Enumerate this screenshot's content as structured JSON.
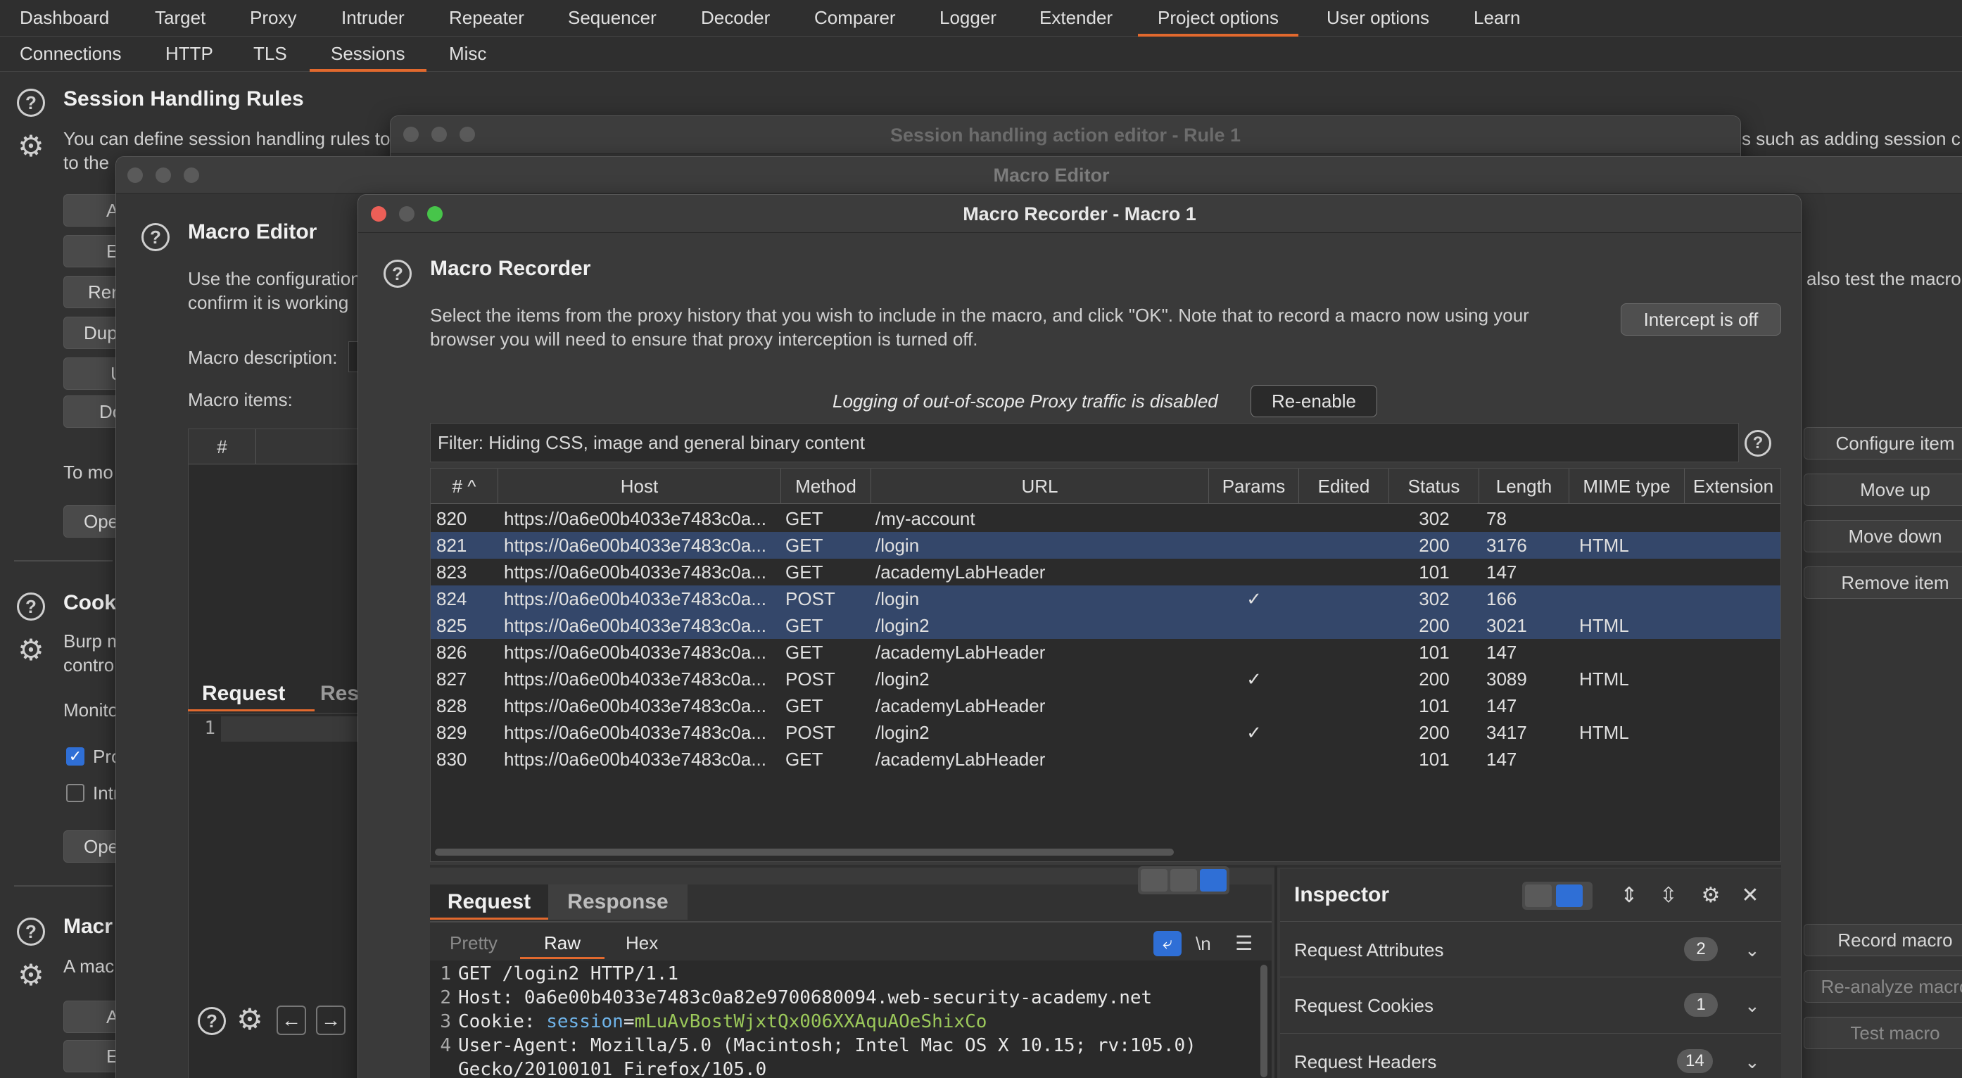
{
  "top_tabs": [
    {
      "label": "Dashboard"
    },
    {
      "label": "Target"
    },
    {
      "label": "Proxy"
    },
    {
      "label": "Intruder"
    },
    {
      "label": "Repeater"
    },
    {
      "label": "Sequencer"
    },
    {
      "label": "Decoder"
    },
    {
      "label": "Comparer"
    },
    {
      "label": "Logger"
    },
    {
      "label": "Extender"
    },
    {
      "label": "Project options"
    },
    {
      "label": "User options"
    },
    {
      "label": "Learn"
    }
  ],
  "sub_tabs": [
    {
      "label": "Connections"
    },
    {
      "label": "HTTP"
    },
    {
      "label": "TLS"
    },
    {
      "label": "Sessions"
    },
    {
      "label": "Misc"
    }
  ],
  "background": {
    "section_title": "Session Handling Rules",
    "desc_line1": "You can define session handling rules to",
    "desc_line1_right": "s such as adding session c",
    "desc_line2": "to the",
    "side_buttons": [
      "A",
      "E",
      "Ren",
      "Dup",
      "U",
      "Do"
    ],
    "to_mo": "To mo",
    "ope": "Ope",
    "cookie_title": "Cook",
    "cookie_desc1": "Burp m",
    "cookie_desc2": "contro",
    "monitor": "Monito",
    "check_proxy": "Pro",
    "check_intruder": "Intr",
    "ope2": "Ope",
    "macro_title": "Macr",
    "macro_desc": "A mac",
    "macro_btn_a": "A",
    "macro_btn_e": "E"
  },
  "session_action_editor": {
    "title": "Session handling action editor - Rule 1"
  },
  "macro_editor": {
    "title": "Macro Editor",
    "heading": "Macro Editor",
    "desc1": "Use the configuration",
    "desc1_right": "also test the macro",
    "desc2": "confirm it is working",
    "macro_description_label": "Macro description:",
    "macro_items_label": "Macro items:",
    "hash_col": "#",
    "request_tab": "Request",
    "response_tab": "Res",
    "line_number": "1",
    "to_mo": "To mo",
    "right_buttons": {
      "configure_item": "Configure item",
      "move_up": "Move up",
      "move_down": "Move down",
      "remove_item": "Remove item",
      "record_macro": "Record macro",
      "reanalyze_macro": "Re-analyze macro",
      "test_macro": "Test macro"
    }
  },
  "macro_recorder": {
    "title": "Macro Recorder - Macro 1",
    "heading": "Macro Recorder",
    "desc1": "Select the items from the proxy history that you wish to include in the macro, and click \"OK\". Note that to record a macro now using your",
    "desc2": "browser you will need to ensure that proxy interception is turned off.",
    "intercept_button": "Intercept is off",
    "logging_notice": "Logging of out-of-scope Proxy traffic is disabled",
    "reenable_button": "Re-enable",
    "filter_text": "Filter: Hiding CSS, image and general binary content",
    "columns": [
      "# ^",
      "Host",
      "Method",
      "URL",
      "Params",
      "Edited",
      "Status",
      "Length",
      "MIME type",
      "Extension"
    ],
    "rows": [
      {
        "num": "820",
        "host": "https://0a6e00b4033e7483c0a...",
        "method": "GET",
        "url": "/my-account",
        "params": "",
        "status": "302",
        "length": "78",
        "mime": "",
        "selected": false
      },
      {
        "num": "821",
        "host": "https://0a6e00b4033e7483c0a...",
        "method": "GET",
        "url": "/login",
        "params": "",
        "status": "200",
        "length": "3176",
        "mime": "HTML",
        "selected": true
      },
      {
        "num": "823",
        "host": "https://0a6e00b4033e7483c0a...",
        "method": "GET",
        "url": "/academyLabHeader",
        "params": "",
        "status": "101",
        "length": "147",
        "mime": "",
        "selected": false
      },
      {
        "num": "824",
        "host": "https://0a6e00b4033e7483c0a...",
        "method": "POST",
        "url": "/login",
        "params": "✓",
        "status": "302",
        "length": "166",
        "mime": "",
        "selected": true
      },
      {
        "num": "825",
        "host": "https://0a6e00b4033e7483c0a...",
        "method": "GET",
        "url": "/login2",
        "params": "",
        "status": "200",
        "length": "3021",
        "mime": "HTML",
        "selected": true
      },
      {
        "num": "826",
        "host": "https://0a6e00b4033e7483c0a...",
        "method": "GET",
        "url": "/academyLabHeader",
        "params": "",
        "status": "101",
        "length": "147",
        "mime": "",
        "selected": false
      },
      {
        "num": "827",
        "host": "https://0a6e00b4033e7483c0a...",
        "method": "POST",
        "url": "/login2",
        "params": "✓",
        "status": "200",
        "length": "3089",
        "mime": "HTML",
        "selected": false
      },
      {
        "num": "828",
        "host": "https://0a6e00b4033e7483c0a...",
        "method": "GET",
        "url": "/academyLabHeader",
        "params": "",
        "status": "101",
        "length": "147",
        "mime": "",
        "selected": false
      },
      {
        "num": "829",
        "host": "https://0a6e00b4033e7483c0a...",
        "method": "POST",
        "url": "/login2",
        "params": "✓",
        "status": "200",
        "length": "3417",
        "mime": "HTML",
        "selected": false
      },
      {
        "num": "830",
        "host": "https://0a6e00b4033e7483c0a...",
        "method": "GET",
        "url": "/academyLabHeader",
        "params": "",
        "status": "101",
        "length": "147",
        "mime": "",
        "selected": false
      }
    ],
    "request_tab": "Request",
    "response_tab": "Response",
    "view_tabs": {
      "pretty": "Pretty",
      "raw": "Raw",
      "hex": "Hex"
    },
    "newline_toggle": "\\n",
    "request_lines": [
      {
        "n": "1",
        "text": "GET /login2 HTTP/1.1"
      },
      {
        "n": "2",
        "text": "Host: 0a6e00b4033e7483c0a82e9700680094.web-security-academy.net"
      },
      {
        "n": "3",
        "key": "Cookie: ",
        "k2": "session",
        "eq": "=",
        "val": "mLuAvBostWjxtQx006XXAquAOeShixCo"
      },
      {
        "n": "4",
        "text": "User-Agent: Mozilla/5.0 (Macintosh; Intel Mac OS X 10.15; rv:105.0)"
      },
      {
        "n": "",
        "text": "Gecko/20100101 Firefox/105.0"
      }
    ],
    "inspector": {
      "title": "Inspector",
      "rows": [
        {
          "label": "Request Attributes",
          "count": "2"
        },
        {
          "label": "Request Cookies",
          "count": "1"
        },
        {
          "label": "Request Headers",
          "count": "14"
        }
      ]
    }
  },
  "colors": {
    "accent": "#e2692e",
    "selection": "#34476a",
    "toggle_on": "#2f6fd6",
    "cookie_value": "#9bc85a",
    "cookie_name": "#6fb3e8"
  }
}
